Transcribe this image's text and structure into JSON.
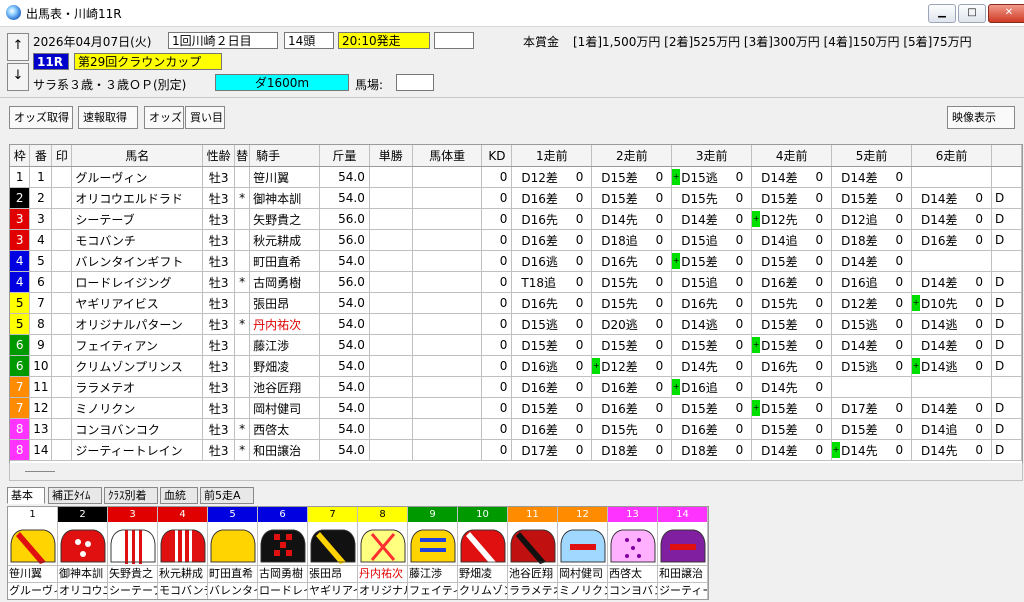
{
  "window": {
    "title": "出馬表・川崎11R",
    "minimize_label": "▁",
    "maximize_label": "□",
    "close_label": "✕"
  },
  "header": {
    "date": "2026年04月07日(火)",
    "meeting": "1回川崎２日目",
    "runners": "14頭",
    "post_time": "20:10発走",
    "race_no": "11R",
    "race_name": "第29回クラウンカップ",
    "conditions": "サラ系３歳・３歳ＯＰ(別定)",
    "distance": "ダ1600m",
    "baba_label": "馬場:",
    "baba_value": "",
    "prize_label": "本賞金",
    "prizes": "[1着]1,500万円 [2着]525万円 [3着]300万円 [4着]150万円 [5着]75万円",
    "up_label": "↑",
    "down_label": "↓"
  },
  "toolbar": {
    "odds": "オッズ取得",
    "sokuho": "速報取得",
    "odds2": "オッズ",
    "kaime": "買い目",
    "video": "映像表示"
  },
  "columns": {
    "waku": "枠",
    "ban": "番",
    "mark": "印",
    "name": "馬名",
    "seirei": "性齢",
    "kae": "替",
    "jockey": "騎手",
    "kinryo": "斤量",
    "tansho": "単勝",
    "weight": "馬体重",
    "kd": "KD",
    "p1": "1走前",
    "p2": "2走前",
    "p3": "3走前",
    "p4": "4走前",
    "p5": "5走前",
    "p6": "6走前"
  },
  "colors": {
    "waku1": "#ffffff",
    "waku2": "#000000",
    "waku3": "#e00000",
    "waku4": "#0000e0",
    "waku5": "#ffff00",
    "waku6": "#009900",
    "waku7": "#ff8c00",
    "waku8": "#ff33ff",
    "post_time_bg": "#ffff00",
    "race_name_bg": "#ffff00",
    "race_no_bg": "#0000cc",
    "distance_bg": "#00ffff",
    "green_mark": "#00e000"
  },
  "horses": [
    {
      "waku": "1",
      "ban": "1",
      "name": "グルーヴィン",
      "seirei": "牡3",
      "kae": "",
      "jockey": "笹川翼",
      "kinryo": "54.0",
      "kd": "0",
      "past": [
        [
          "",
          "D12差",
          "0"
        ],
        [
          "",
          "D15差",
          "0"
        ],
        [
          "on",
          "D15逃",
          "0"
        ],
        [
          "",
          "D14差",
          "0"
        ],
        [
          "",
          "D14差",
          "0"
        ],
        [
          "",
          "",
          " "
        ]
      ]
    },
    {
      "waku": "2",
      "ban": "2",
      "name": "オリコウエルドラド",
      "seirei": "牡3",
      "kae": "*",
      "jockey": "御神本訓",
      "kinryo": "54.0",
      "kd": "0",
      "past": [
        [
          "",
          "D16差",
          "0"
        ],
        [
          "",
          "D15差",
          "0"
        ],
        [
          "",
          "D15先",
          "0"
        ],
        [
          "",
          "D15差",
          "0"
        ],
        [
          "",
          "D15差",
          "0"
        ],
        [
          "",
          "D14差",
          "0"
        ]
      ]
    },
    {
      "waku": "3",
      "ban": "3",
      "name": "シーテーブ",
      "seirei": "牡3",
      "kae": "",
      "jockey": "矢野貴之",
      "kinryo": "56.0",
      "kd": "0",
      "past": [
        [
          "",
          "D16先",
          "0"
        ],
        [
          "",
          "D14先",
          "0"
        ],
        [
          "",
          "D14差",
          "0"
        ],
        [
          "on",
          "D12先",
          "0"
        ],
        [
          "",
          "D12追",
          "0"
        ],
        [
          "",
          "D14差",
          "0"
        ]
      ]
    },
    {
      "waku": "3",
      "ban": "4",
      "name": "モコバンチ",
      "seirei": "牡3",
      "kae": "",
      "jockey": "秋元耕成",
      "kinryo": "56.0",
      "kd": "0",
      "past": [
        [
          "",
          "D16差",
          "0"
        ],
        [
          "",
          "D18追",
          "0"
        ],
        [
          "",
          "D15追",
          "0"
        ],
        [
          "",
          "D14追",
          "0"
        ],
        [
          "",
          "D18差",
          "0"
        ],
        [
          "",
          "D16差",
          "0"
        ]
      ]
    },
    {
      "waku": "4",
      "ban": "5",
      "name": "バレンタインギフト",
      "seirei": "牡3",
      "kae": "",
      "jockey": "町田直希",
      "kinryo": "54.0",
      "kd": "0",
      "past": [
        [
          "",
          "D16逃",
          "0"
        ],
        [
          "",
          "D16先",
          "0"
        ],
        [
          "on",
          "D15差",
          "0"
        ],
        [
          "",
          "D15差",
          "0"
        ],
        [
          "",
          "D14差",
          "0"
        ],
        [
          "",
          "",
          " "
        ]
      ]
    },
    {
      "waku": "4",
      "ban": "6",
      "name": "ロードレイジング",
      "seirei": "牡3",
      "kae": "*",
      "jockey": "古岡勇樹",
      "kinryo": "56.0",
      "kd": "0",
      "past": [
        [
          "",
          "T18追",
          "0"
        ],
        [
          "",
          "D15先",
          "0"
        ],
        [
          "",
          "D15追",
          "0"
        ],
        [
          "",
          "D16差",
          "0"
        ],
        [
          "",
          "D16追",
          "0"
        ],
        [
          "",
          "D14差",
          "0"
        ]
      ]
    },
    {
      "waku": "5",
      "ban": "7",
      "name": "ヤギリアイビス",
      "seirei": "牡3",
      "kae": "",
      "jockey": "張田昂",
      "kinryo": "54.0",
      "kd": "0",
      "past": [
        [
          "",
          "D16先",
          "0"
        ],
        [
          "",
          "D15先",
          "0"
        ],
        [
          "",
          "D16先",
          "0"
        ],
        [
          "",
          "D15先",
          "0"
        ],
        [
          "",
          "D12差",
          "0"
        ],
        [
          "on",
          "D10先",
          "0"
        ]
      ]
    },
    {
      "waku": "5",
      "ban": "8",
      "name": "オリジナルパターン",
      "seirei": "牡3",
      "kae": "*",
      "jockey": "丹内祐次",
      "jred": true,
      "kinryo": "54.0",
      "kd": "0",
      "past": [
        [
          "",
          "D15逃",
          "0"
        ],
        [
          "",
          "D20逃",
          "0"
        ],
        [
          "",
          "D14逃",
          "0"
        ],
        [
          "",
          "D15差",
          "0"
        ],
        [
          "",
          "D15逃",
          "0"
        ],
        [
          "",
          "D14逃",
          "0"
        ]
      ]
    },
    {
      "waku": "6",
      "ban": "9",
      "name": "フェイティアン",
      "seirei": "牡3",
      "kae": "",
      "jockey": "藤江渉",
      "kinryo": "54.0",
      "kd": "0",
      "past": [
        [
          "",
          "D15差",
          "0"
        ],
        [
          "",
          "D15差",
          "0"
        ],
        [
          "",
          "D15差",
          "0"
        ],
        [
          "on",
          "D15差",
          "0"
        ],
        [
          "",
          "D14差",
          "0"
        ],
        [
          "",
          "D14差",
          "0"
        ]
      ]
    },
    {
      "waku": "6",
      "ban": "10",
      "name": "クリムゾンプリンス",
      "seirei": "牡3",
      "kae": "",
      "jockey": "野畑凌",
      "kinryo": "54.0",
      "kd": "0",
      "past": [
        [
          "",
          "D16逃",
          "0"
        ],
        [
          "on",
          "D12差",
          "0"
        ],
        [
          "",
          "D14先",
          "0"
        ],
        [
          "",
          "D16先",
          "0"
        ],
        [
          "",
          "D15逃",
          "0"
        ],
        [
          "on",
          "D14逃",
          "0"
        ]
      ]
    },
    {
      "waku": "7",
      "ban": "11",
      "name": "ララメテオ",
      "seirei": "牡3",
      "kae": "",
      "jockey": "池谷匠翔",
      "kinryo": "54.0",
      "kd": "0",
      "past": [
        [
          "",
          "D16差",
          "0"
        ],
        [
          "",
          "D16差",
          "0"
        ],
        [
          "on",
          "D16追",
          "0"
        ],
        [
          "",
          "D14先",
          "0"
        ],
        [
          "",
          "",
          ""
        ],
        [
          "",
          "",
          ""
        ]
      ]
    },
    {
      "waku": "7",
      "ban": "12",
      "name": "ミノリクン",
      "seirei": "牡3",
      "kae": "",
      "jockey": "岡村健司",
      "kinryo": "54.0",
      "kd": "0",
      "past": [
        [
          "",
          "D15差",
          "0"
        ],
        [
          "",
          "D16差",
          "0"
        ],
        [
          "",
          "D15差",
          "0"
        ],
        [
          "on",
          "D15差",
          "0"
        ],
        [
          "",
          "D17差",
          "0"
        ],
        [
          "",
          "D14差",
          "0"
        ]
      ]
    },
    {
      "waku": "8",
      "ban": "13",
      "name": "コンヨバンコク",
      "seirei": "牡3",
      "kae": "*",
      "jockey": "西啓太",
      "kinryo": "54.0",
      "kd": "0",
      "past": [
        [
          "",
          "D16差",
          "0"
        ],
        [
          "",
          "D15先",
          "0"
        ],
        [
          "",
          "D16差",
          "0"
        ],
        [
          "",
          "D15差",
          "0"
        ],
        [
          "",
          "D15差",
          "0"
        ],
        [
          "",
          "D14追",
          "0"
        ]
      ]
    },
    {
      "waku": "8",
      "ban": "14",
      "name": "ジーティートレイン",
      "seirei": "牡3",
      "kae": "*",
      "jockey": "和田譲治",
      "kinryo": "54.0",
      "kd": "0",
      "past": [
        [
          "",
          "D17差",
          "0"
        ],
        [
          "",
          "D18差",
          "0"
        ],
        [
          "",
          "D18差",
          "0"
        ],
        [
          "",
          "D14差",
          "0"
        ],
        [
          "on",
          "D14先",
          "0"
        ],
        [
          "",
          "D14先",
          "0"
        ]
      ]
    }
  ],
  "extra_col_char": "D",
  "tabs": [
    "基本",
    "補正ﾀｲﾑ",
    "ｸﾗｽ別着",
    "血統",
    "前5走A"
  ],
  "silks": [
    {
      "num": "1",
      "jockey": "笹川翼",
      "horse": "グルーヴィ"
    },
    {
      "num": "2",
      "jockey": "御神本訓",
      "horse": "オリコウエ"
    },
    {
      "num": "3",
      "jockey": "矢野貴之",
      "horse": "シーテーブ"
    },
    {
      "num": "4",
      "jockey": "秋元耕成",
      "horse": "モコバンチ"
    },
    {
      "num": "5",
      "jockey": "町田直希",
      "horse": "バレンタイ"
    },
    {
      "num": "6",
      "jockey": "古岡勇樹",
      "horse": "ロードレイ"
    },
    {
      "num": "7",
      "jockey": "張田昂",
      "horse": "ヤギリアイ"
    },
    {
      "num": "8",
      "jockey": "丹内祐次",
      "horse": "オリジナル"
    },
    {
      "num": "9",
      "jockey": "藤江渉",
      "horse": "フェイティ"
    },
    {
      "num": "10",
      "jockey": "野畑凌",
      "horse": "クリムゾン"
    },
    {
      "num": "11",
      "jockey": "池谷匠翔",
      "horse": "ララメテオ"
    },
    {
      "num": "12",
      "jockey": "岡村健司",
      "horse": "ミノリクン"
    },
    {
      "num": "13",
      "jockey": "西啓太",
      "horse": "コンヨバン"
    },
    {
      "num": "14",
      "jockey": "和田譲治",
      "horse": "ジーティー"
    }
  ]
}
